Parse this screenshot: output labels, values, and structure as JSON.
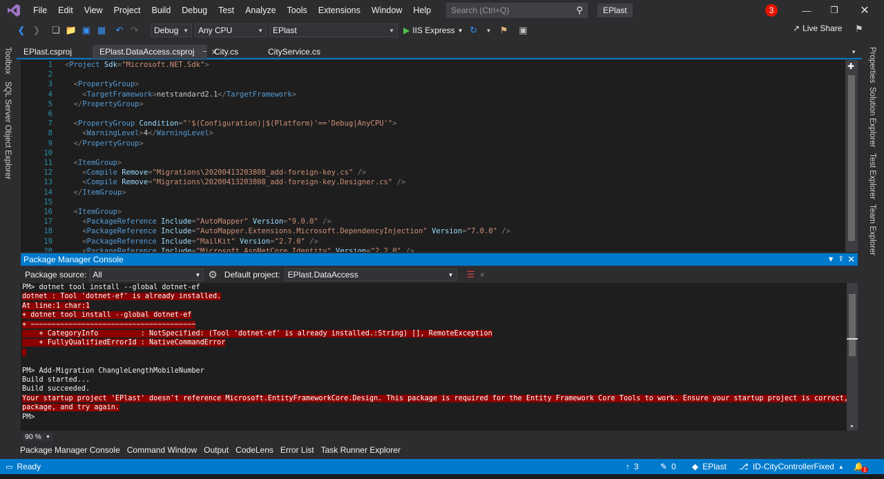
{
  "menu": [
    "File",
    "Edit",
    "View",
    "Project",
    "Build",
    "Debug",
    "Test",
    "Analyze",
    "Tools",
    "Extensions",
    "Window",
    "Help"
  ],
  "search": {
    "placeholder": "Search (Ctrl+Q)"
  },
  "solution_name": "EPlast",
  "notifications_count": "3",
  "toolbar": {
    "config": "Debug",
    "platform": "Any CPU",
    "startup_project": "EPlast",
    "run_target": "IIS Express",
    "live_share": "Live Share"
  },
  "left_tools": [
    "Toolbox",
    "SQL Server Object Explorer"
  ],
  "right_tools": [
    "Properties",
    "Solution Explorer",
    "Test Explorer",
    "Team Explorer"
  ],
  "doc_tabs": [
    "EPlast.csproj",
    "EPlast.DataAccess.csproj",
    "City.cs",
    "CityService.cs"
  ],
  "editor": {
    "line_numbers": [
      "1",
      "2",
      "3",
      "4",
      "5",
      "6",
      "7",
      "8",
      "9",
      "10",
      "11",
      "12",
      "13",
      "14",
      "15",
      "16",
      "17",
      "18",
      "19",
      "20"
    ]
  },
  "pmc": {
    "title": "Package Manager Console",
    "source_label": "Package source:",
    "source_value": "All",
    "project_label": "Default project:",
    "project_value": "EPlast.DataAccess",
    "lines": [
      {
        "text": "PM> dotnet tool install --global dotnet-ef",
        "err": false
      },
      {
        "text": "dotnet : Tool 'dotnet-ef' is already installed.",
        "err": true
      },
      {
        "text": "At line:1 char:1",
        "err": true
      },
      {
        "text": "+ dotnet tool install --global dotnet-ef",
        "err": true
      },
      {
        "text": "+ ~~~~~~~~~~~~~~~~~~~~~~~~~~~~~~~~~~~~~~~",
        "err": true
      },
      {
        "text": "    + CategoryInfo          : NotSpecified: (Tool 'dotnet-ef' is already installed.:String) [], RemoteException",
        "err": true
      },
      {
        "text": "    + FullyQualifiedErrorId : NativeCommandError",
        "err": true
      },
      {
        "text": " ",
        "err": true
      },
      {
        "text": "PM> Add-Migration ChangleLengthMobileNumber",
        "err": false
      },
      {
        "text": "Build started...",
        "err": false
      },
      {
        "text": "Build succeeded.",
        "err": false
      },
      {
        "text": "Your startup project 'EPlast' doesn't reference Microsoft.EntityFrameworkCore.Design. This package is required for the Entity Framework Core Tools to work. Ensure your startup project is correct, install the",
        "err": true
      },
      {
        "text": "package, and try again.",
        "err": true
      },
      {
        "text": "PM>",
        "err": false
      }
    ],
    "zoom": "90 %"
  },
  "bottom_tabs": [
    "Package Manager Console",
    "Command Window",
    "Output",
    "CodeLens",
    "Error List",
    "Task Runner Explorer"
  ],
  "status": {
    "ready": "Ready",
    "up_count": "3",
    "pencil_count": "0",
    "repo": "EPlast",
    "branch": "ID-CityControllerFixed",
    "bell_count": "1"
  },
  "colors": {
    "accent": "#007acc",
    "error_bg": "#8b0000",
    "badge": "#e51400"
  }
}
